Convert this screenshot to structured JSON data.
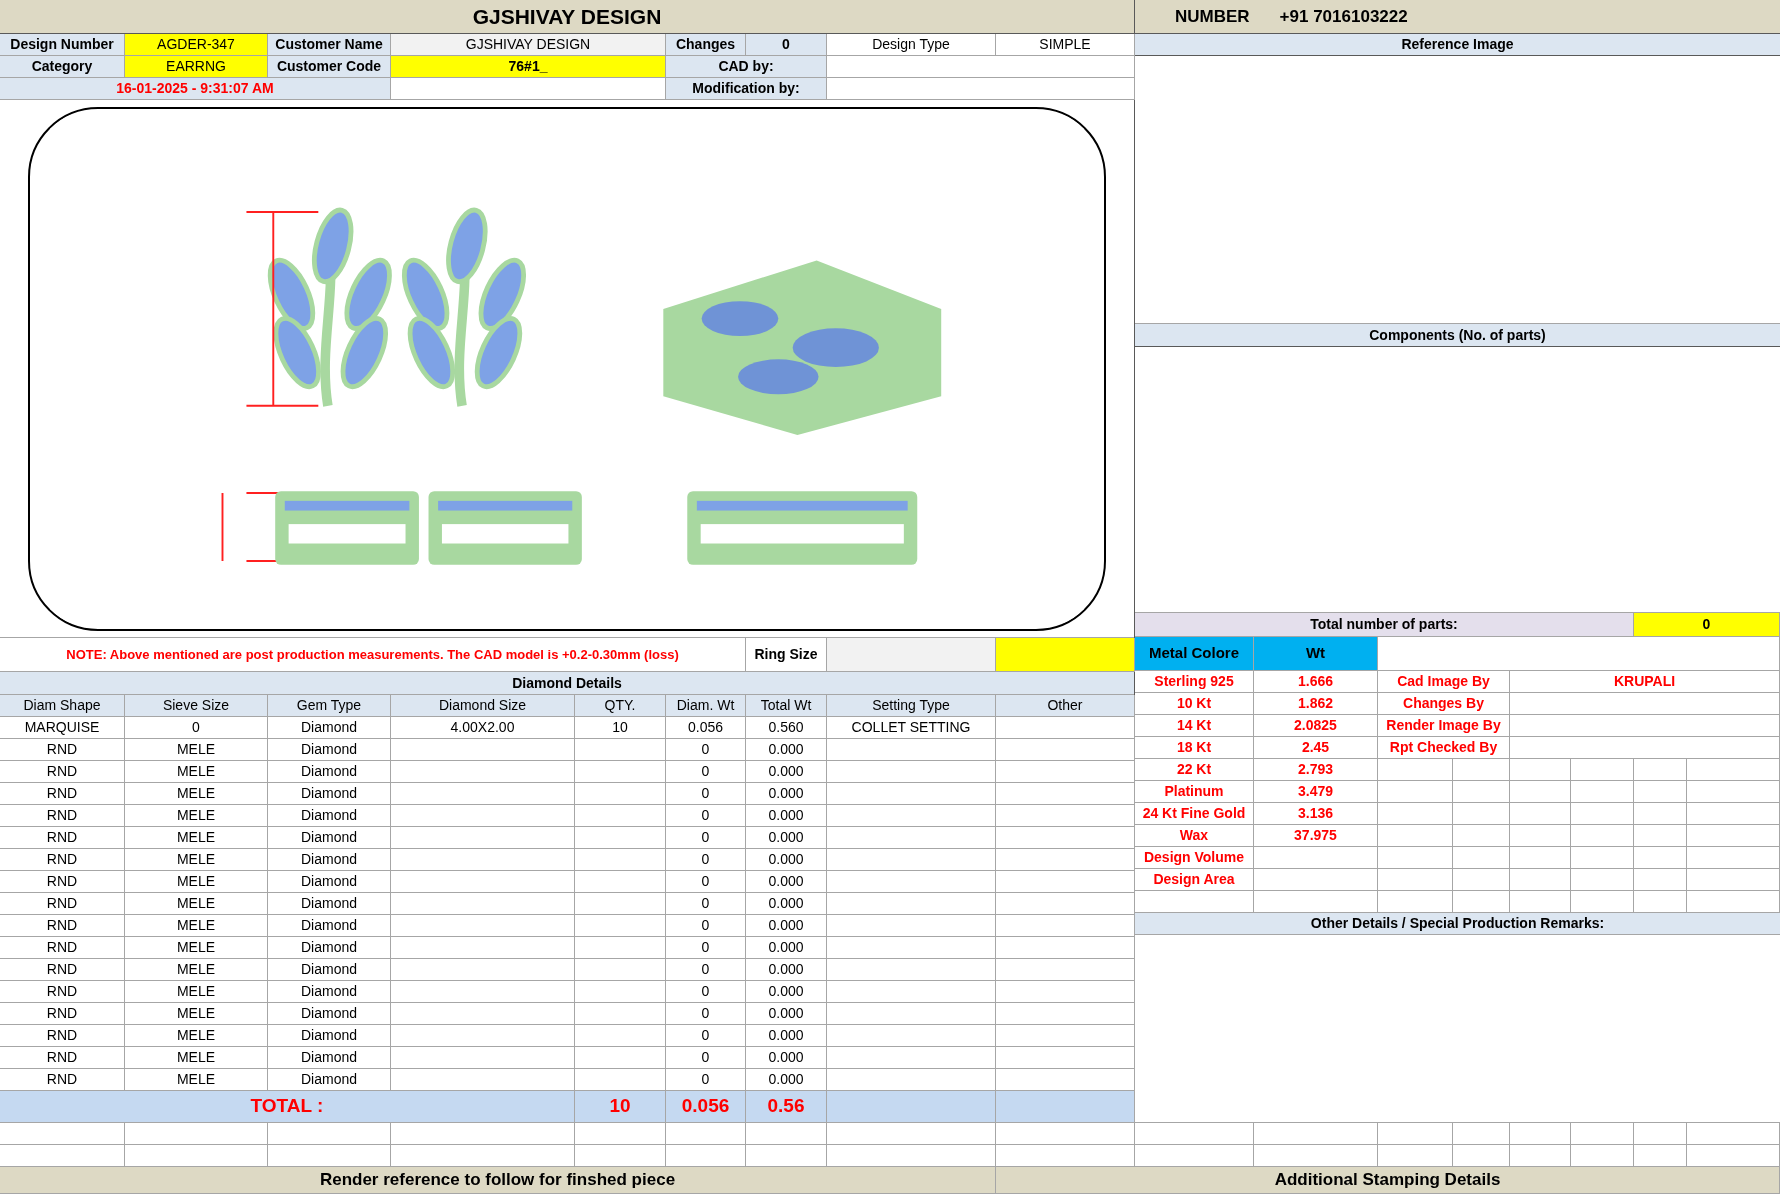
{
  "title": "GJSHIVAY DESIGN",
  "contact": {
    "label": "NUMBER",
    "value": "+91 7016103222"
  },
  "header": {
    "design_number_label": "Design Number",
    "design_number": "AGDER-347",
    "customer_name_label": "Customer Name",
    "customer_name": "GJSHIVAY DESIGN",
    "changes_label": "Changes",
    "changes": "0",
    "design_type_label": "Design Type",
    "design_type": "SIMPLE",
    "category_label": "Category",
    "category": "EARRNG",
    "customer_code_label": "Customer Code",
    "customer_code": "76#1_",
    "cad_by_label": "CAD by:",
    "date": "16-01-2025 - 9:31:07 AM",
    "modification_by_label": "Modification by:"
  },
  "note": "NOTE: Above mentioned are post production measurements. The CAD model is +0.2-0.30mm (loss)",
  "ring_size_label": "Ring Size",
  "diamond_details": {
    "title": "Diamond Details",
    "columns": [
      "Diam Shape",
      "Sieve Size",
      "Gem Type",
      "Diamond Size",
      "QTY.",
      "Diam. Wt",
      "Total Wt",
      "Setting Type",
      "Other"
    ],
    "rows": [
      {
        "diam_shape": "MARQUISE",
        "sieve_size": "0",
        "gem_type": "Diamond",
        "diamond_size": "4.00X2.00",
        "qty": "10",
        "diam_wt": "0.056",
        "total_wt": "0.560",
        "setting_type": "COLLET SETTING"
      },
      {
        "diam_shape": "RND",
        "sieve_size": "MELE",
        "gem_type": "Diamond",
        "diam_wt": "0",
        "total_wt": "0.000"
      },
      {
        "diam_shape": "RND",
        "sieve_size": "MELE",
        "gem_type": "Diamond",
        "diam_wt": "0",
        "total_wt": "0.000"
      },
      {
        "diam_shape": "RND",
        "sieve_size": "MELE",
        "gem_type": "Diamond",
        "diam_wt": "0",
        "total_wt": "0.000"
      },
      {
        "diam_shape": "RND",
        "sieve_size": "MELE",
        "gem_type": "Diamond",
        "diam_wt": "0",
        "total_wt": "0.000"
      },
      {
        "diam_shape": "RND",
        "sieve_size": "MELE",
        "gem_type": "Diamond",
        "diam_wt": "0",
        "total_wt": "0.000"
      },
      {
        "diam_shape": "RND",
        "sieve_size": "MELE",
        "gem_type": "Diamond",
        "diam_wt": "0",
        "total_wt": "0.000"
      },
      {
        "diam_shape": "RND",
        "sieve_size": "MELE",
        "gem_type": "Diamond",
        "diam_wt": "0",
        "total_wt": "0.000"
      },
      {
        "diam_shape": "RND",
        "sieve_size": "MELE",
        "gem_type": "Diamond",
        "diam_wt": "0",
        "total_wt": "0.000"
      },
      {
        "diam_shape": "RND",
        "sieve_size": "MELE",
        "gem_type": "Diamond",
        "diam_wt": "0",
        "total_wt": "0.000"
      },
      {
        "diam_shape": "RND",
        "sieve_size": "MELE",
        "gem_type": "Diamond",
        "diam_wt": "0",
        "total_wt": "0.000"
      },
      {
        "diam_shape": "RND",
        "sieve_size": "MELE",
        "gem_type": "Diamond",
        "diam_wt": "0",
        "total_wt": "0.000"
      },
      {
        "diam_shape": "RND",
        "sieve_size": "MELE",
        "gem_type": "Diamond",
        "diam_wt": "0",
        "total_wt": "0.000"
      },
      {
        "diam_shape": "RND",
        "sieve_size": "MELE",
        "gem_type": "Diamond",
        "diam_wt": "0",
        "total_wt": "0.000"
      },
      {
        "diam_shape": "RND",
        "sieve_size": "MELE",
        "gem_type": "Diamond",
        "diam_wt": "0",
        "total_wt": "0.000"
      },
      {
        "diam_shape": "RND",
        "sieve_size": "MELE",
        "gem_type": "Diamond",
        "diam_wt": "0",
        "total_wt": "0.000"
      },
      {
        "diam_shape": "RND",
        "sieve_size": "MELE",
        "gem_type": "Diamond",
        "diam_wt": "0",
        "total_wt": "0.000"
      }
    ],
    "total": {
      "label": "TOTAL :",
      "qty": "10",
      "diam_wt": "0.056",
      "total_wt": "0.56"
    }
  },
  "reference_image_title": "Reference Image",
  "components_title": "Components (No. of parts)",
  "total_parts": {
    "label": "Total number of parts:",
    "value": "0"
  },
  "metal_table": {
    "columns": [
      "Metal Colore",
      "Wt"
    ],
    "rows": [
      {
        "metal": "Sterling 925",
        "wt": "1.666"
      },
      {
        "metal": "10 Kt",
        "wt": "1.862"
      },
      {
        "metal": "14 Kt",
        "wt": "2.0825"
      },
      {
        "metal": "18 Kt",
        "wt": "2.45"
      },
      {
        "metal": "22 Kt",
        "wt": "2.793"
      },
      {
        "metal": "Platinum",
        "wt": "3.479"
      },
      {
        "metal": "24 Kt Fine Gold",
        "wt": "3.136"
      },
      {
        "metal": "Wax",
        "wt": "37.975"
      },
      {
        "metal": "Design Volume"
      },
      {
        "metal": "Design Area"
      }
    ]
  },
  "staff": [
    {
      "label": "Cad Image By",
      "value": "KRUPALI"
    },
    {
      "label": "Changes By"
    },
    {
      "label": "Render Image By"
    },
    {
      "label": "Rpt Checked By"
    }
  ],
  "remarks_title": "Other Details / Special Production Remarks:",
  "footer": [
    "Render reference to follow for finshed piece",
    "Additional Stamping Details"
  ]
}
